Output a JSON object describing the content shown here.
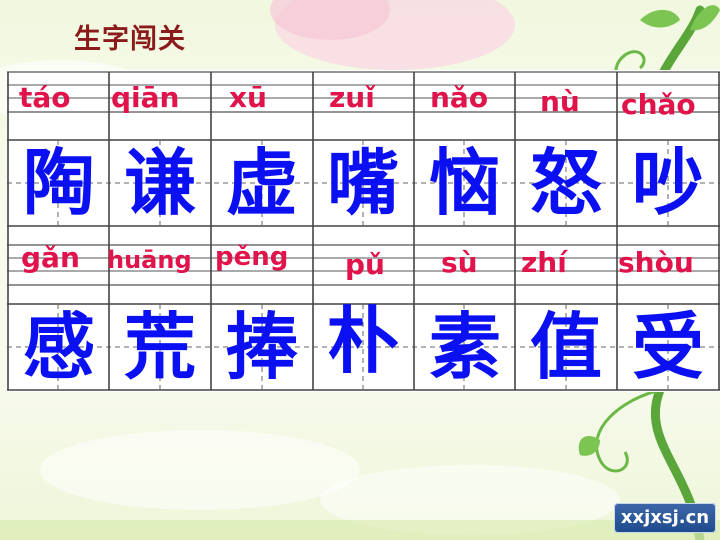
{
  "title": "生字闯关",
  "rows": [
    {
      "cells": [
        {
          "pinyin": "táo",
          "char": "陶"
        },
        {
          "pinyin": "qiān",
          "char": "谦"
        },
        {
          "pinyin": "xū",
          "char": "虚"
        },
        {
          "pinyin": "zuǐ",
          "char": "嘴"
        },
        {
          "pinyin": "nǎo",
          "char": "恼"
        },
        {
          "pinyin": "nù",
          "char": "怒"
        },
        {
          "pinyin": "chǎo",
          "char": "吵"
        }
      ]
    },
    {
      "cells": [
        {
          "pinyin": "gǎn",
          "char": "感"
        },
        {
          "pinyin": "huāng",
          "char": "荒"
        },
        {
          "pinyin": "pěng",
          "char": "捧"
        },
        {
          "pinyin": "pǔ",
          "char": "朴"
        },
        {
          "pinyin": "sù",
          "char": "素"
        },
        {
          "pinyin": "zhí",
          "char": "值"
        },
        {
          "pinyin": "shòu",
          "char": "受"
        }
      ]
    }
  ],
  "watermark": "xxjxsj.cn",
  "colors": {
    "title": "#8b1a1a",
    "pinyin": "#e0134b",
    "hanzi": "#0b10f2",
    "grid_line": "#555555",
    "vine": "#5aa63a"
  }
}
